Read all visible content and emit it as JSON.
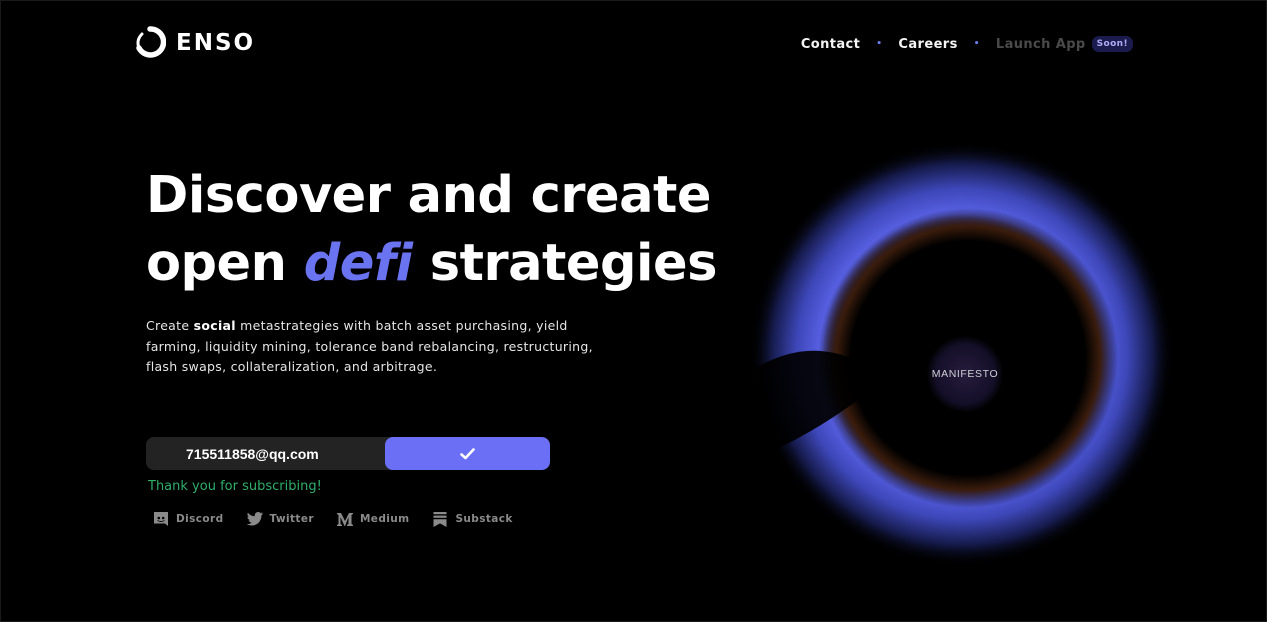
{
  "brand": {
    "name": "ENSO"
  },
  "nav": {
    "contact": "Contact",
    "careers": "Careers",
    "launch": "Launch App",
    "badge": "Soon!",
    "separator": "•"
  },
  "hero": {
    "title_line1": "Discover and create",
    "title_line2_pre": "open",
    "title_accent": "defi",
    "title_line2_post": "strategies",
    "desc_pre": "Create",
    "desc_bold": "social",
    "desc_post": "metastrategies with batch asset purchasing, yield farming, liquidity mining, tolerance band rebalancing, restructuring, flash swaps, collateralization, and arbitrage."
  },
  "form": {
    "email_value": "715511858@qq.com",
    "success": "Thank you for subscribing!"
  },
  "social": [
    {
      "label": "Discord",
      "icon": "discord-icon"
    },
    {
      "label": "Twitter",
      "icon": "twitter-icon"
    },
    {
      "label": "Medium",
      "icon": "medium-icon"
    },
    {
      "label": "Substack",
      "icon": "substack-icon"
    }
  ],
  "orb": {
    "label": "MANIFESTO"
  },
  "colors": {
    "accent": "#6a6ff5",
    "success": "#2fae6a",
    "background": "#000000"
  }
}
